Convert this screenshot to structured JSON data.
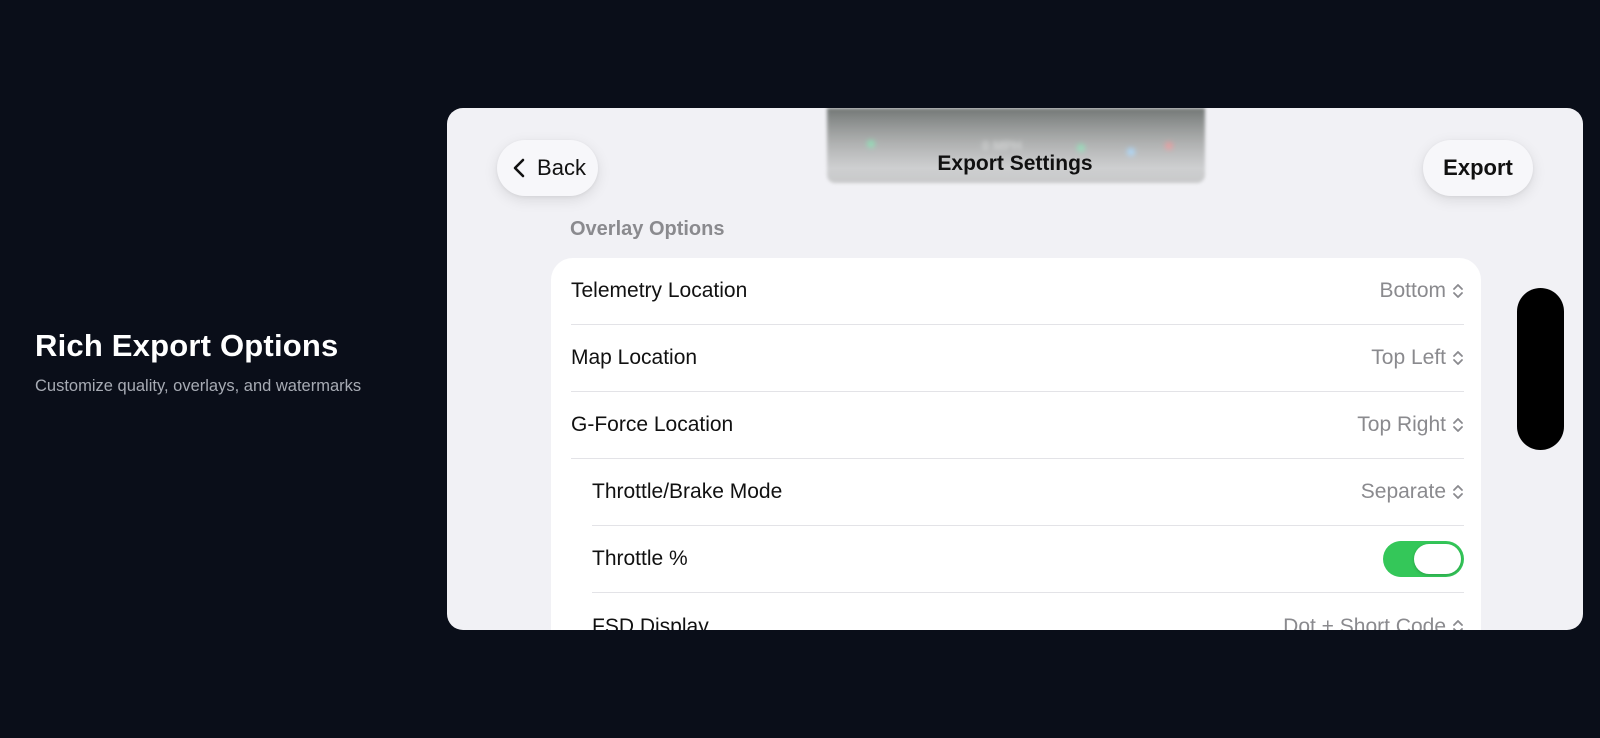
{
  "promo": {
    "title": "Rich Export Options",
    "subtitle": "Customize quality, overlays, and watermarks"
  },
  "nav": {
    "back_label": "Back",
    "title": "Export Settings",
    "export_label": "Export",
    "preview_ghost_text": "0 MPH"
  },
  "section": {
    "header": "Overlay Options"
  },
  "rows": [
    {
      "label": "Telemetry Location",
      "value": "Bottom"
    },
    {
      "label": "Map Location",
      "value": "Top Left"
    },
    {
      "label": "G-Force Location",
      "value": "Top Right"
    },
    {
      "label": "Throttle/Brake Mode",
      "value": "Separate"
    },
    {
      "label": "Throttle %",
      "toggle_on": true
    },
    {
      "label": "FSD Display",
      "value": "Dot + Short Code"
    }
  ],
  "colors": {
    "background": "#0a0e19",
    "toggle_on": "#34c759",
    "secondary_text": "#8a8a8e"
  },
  "icons": {
    "back": "chevron-left-icon",
    "picker": "chevron-up-down-icon"
  }
}
